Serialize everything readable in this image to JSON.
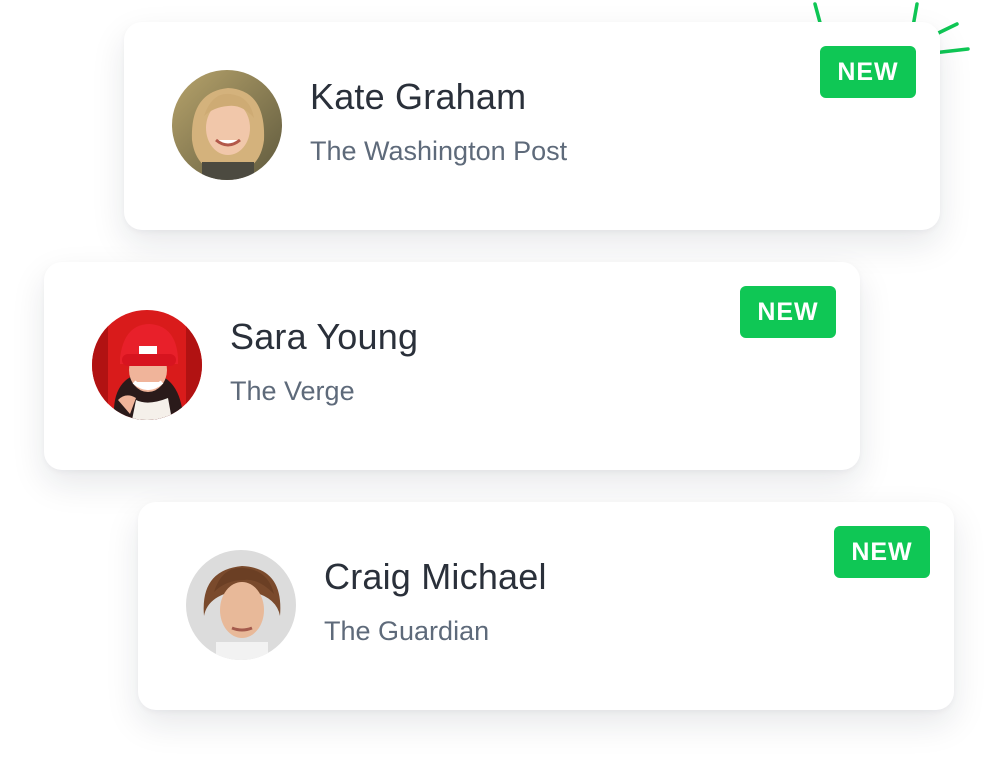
{
  "colors": {
    "accent": "#0fc755",
    "name_text": "#2a303a",
    "outlet_text": "#5e6a7a",
    "card_bg": "#ffffff"
  },
  "cards": [
    {
      "name": "Kate Graham",
      "outlet": "The Washington Post",
      "badge": "NEW",
      "avatar": "avatar-kate-graham"
    },
    {
      "name": "Sara Young",
      "outlet": "The Verge",
      "badge": "NEW",
      "avatar": "avatar-sara-young"
    },
    {
      "name": "Craig Michael",
      "outlet": "The Guardian",
      "badge": "NEW",
      "avatar": "avatar-craig-michael"
    }
  ],
  "decorations": {
    "sparkle_icon": "sparkle-burst-icon"
  }
}
